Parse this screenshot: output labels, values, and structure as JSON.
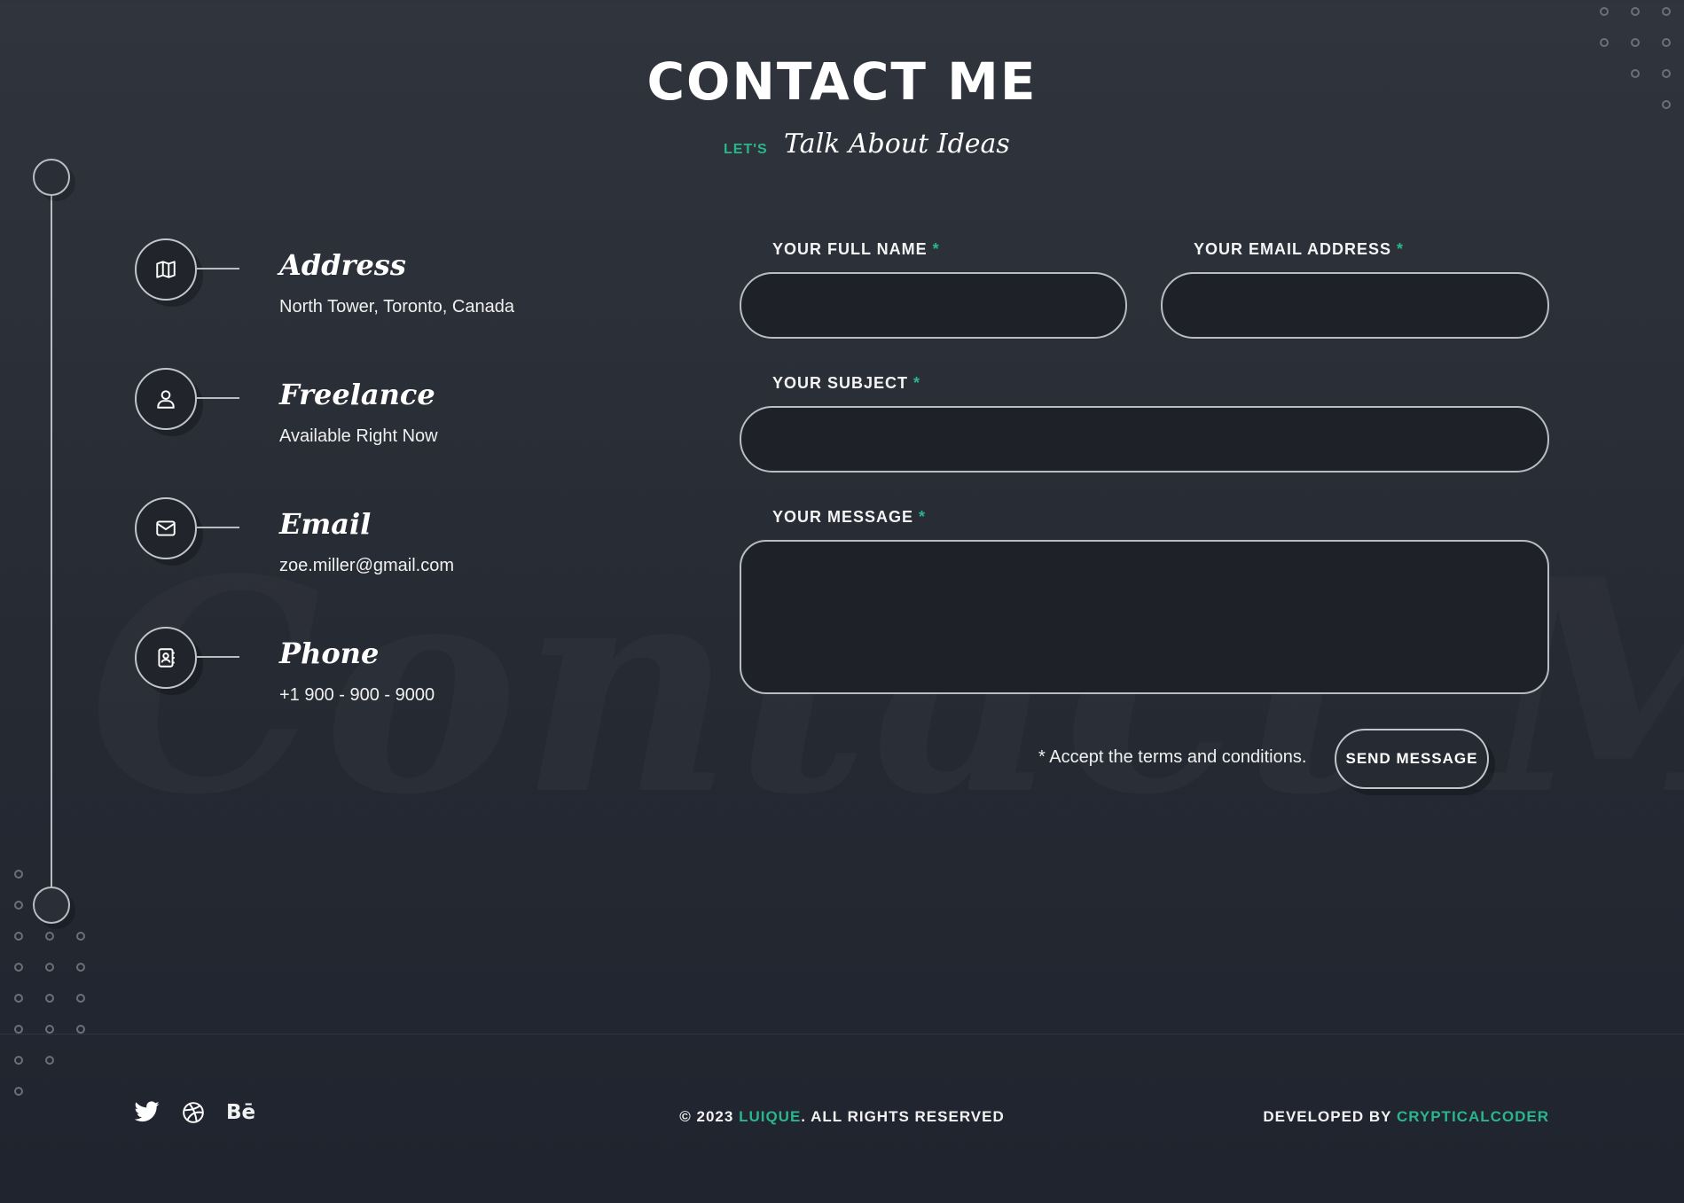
{
  "header": {
    "title": "CONTACT ME",
    "subtitle_prefix": "LET'S",
    "subtitle": "Talk About Ideas"
  },
  "watermark": "Contact Me",
  "info_items": [
    {
      "icon": "map-icon",
      "title": "Address",
      "value": "North Tower, Toronto, Canada"
    },
    {
      "icon": "user-icon",
      "title": "Freelance",
      "value": "Available Right Now"
    },
    {
      "icon": "mail-icon",
      "title": "Email",
      "value": "zoe.miller@gmail.com"
    },
    {
      "icon": "contact-book-icon",
      "title": "Phone",
      "value": "+1 900 - 900 - 9000"
    }
  ],
  "form": {
    "full_name_label": "YOUR FULL NAME",
    "email_label": "YOUR EMAIL ADDRESS",
    "subject_label": "YOUR SUBJECT",
    "message_label": "YOUR MESSAGE",
    "required_mark": "*",
    "full_name_value": "",
    "email_value": "",
    "subject_value": "",
    "message_value": "",
    "terms_text": "* Accept the terms and conditions.",
    "submit_label": "SEND MESSAGE"
  },
  "footer": {
    "social": [
      "twitter-icon",
      "dribbble-icon",
      "behance-icon"
    ],
    "copyright_prefix": "© 2023",
    "brand": "LUIQUE",
    "copyright_suffix": ". ALL RIGHTS RESERVED",
    "developed_prefix": "DEVELOPED BY",
    "developer": "CRYPTICALCODER"
  },
  "colors": {
    "accent": "#2bb58d",
    "background": "#2a2e36",
    "field_background": "#1f2129",
    "border": "#b9bcc2"
  }
}
